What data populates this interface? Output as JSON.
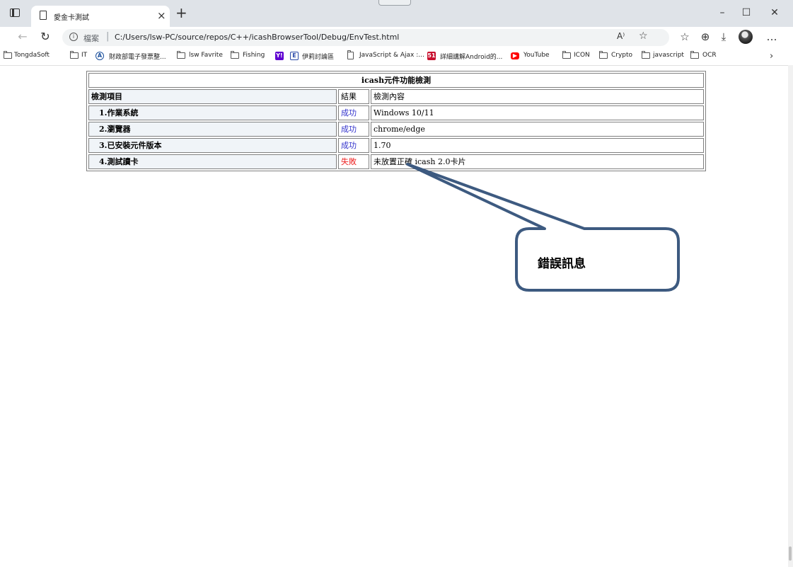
{
  "browser": {
    "tab_title": "愛金卡測試",
    "new_tab": "+",
    "tab_close": "×",
    "window_minimize": "–",
    "window_maximize": "☐",
    "window_close": "✕"
  },
  "address_bar": {
    "file_label": "檔案",
    "separator": "|",
    "url": "C:/Users/lsw-PC/source/repos/C++/icashBrowserTool/Debug/EnvTest.html",
    "read_aloud": "A⁾",
    "more": "…"
  },
  "bookmarks": [
    {
      "label": "TongdaSoft",
      "icon": "folder-icon"
    },
    {
      "label": "IT",
      "icon": "folder-icon"
    },
    {
      "label": "財政部電子發票整...",
      "icon": "mof-icon"
    },
    {
      "label": "lsw Favrite",
      "icon": "folder-icon"
    },
    {
      "label": "Fishing",
      "icon": "folder-icon"
    },
    {
      "label": "",
      "icon": "yahoo-icon"
    },
    {
      "label": "伊莉討論區",
      "icon": "eyny-icon"
    },
    {
      "label": "JavaScript & Ajax :...",
      "icon": "page-icon"
    },
    {
      "label": "詳細講解Android的...",
      "icon": "51cto-icon"
    },
    {
      "label": "YouTube",
      "icon": "youtube-icon"
    },
    {
      "label": "ICON",
      "icon": "folder-icon"
    },
    {
      "label": "Crypto",
      "icon": "folder-icon"
    },
    {
      "label": "javascript",
      "icon": "folder-icon"
    },
    {
      "label": "OCR",
      "icon": "folder-icon"
    }
  ],
  "table": {
    "title": "icash元件功能檢測",
    "headers": [
      "檢測項目",
      "結果",
      "檢測內容"
    ],
    "rows": [
      {
        "item": "1.作業系統",
        "result": "成功",
        "detail": "Windows 10/11"
      },
      {
        "item": "2.瀏覽器",
        "result": "成功",
        "detail": "chrome/edge"
      },
      {
        "item": "3.已安裝元件版本",
        "result": "成功",
        "detail": "1.70"
      },
      {
        "item": "4.測試讀卡",
        "result": "失敗",
        "detail": "未放置正確 icash 2.0卡片"
      }
    ]
  },
  "callout": {
    "text": "錯誤訊息"
  },
  "colors": {
    "success": "#3333cc",
    "fail": "#ee2222",
    "callout_border": "#3d5a80"
  }
}
